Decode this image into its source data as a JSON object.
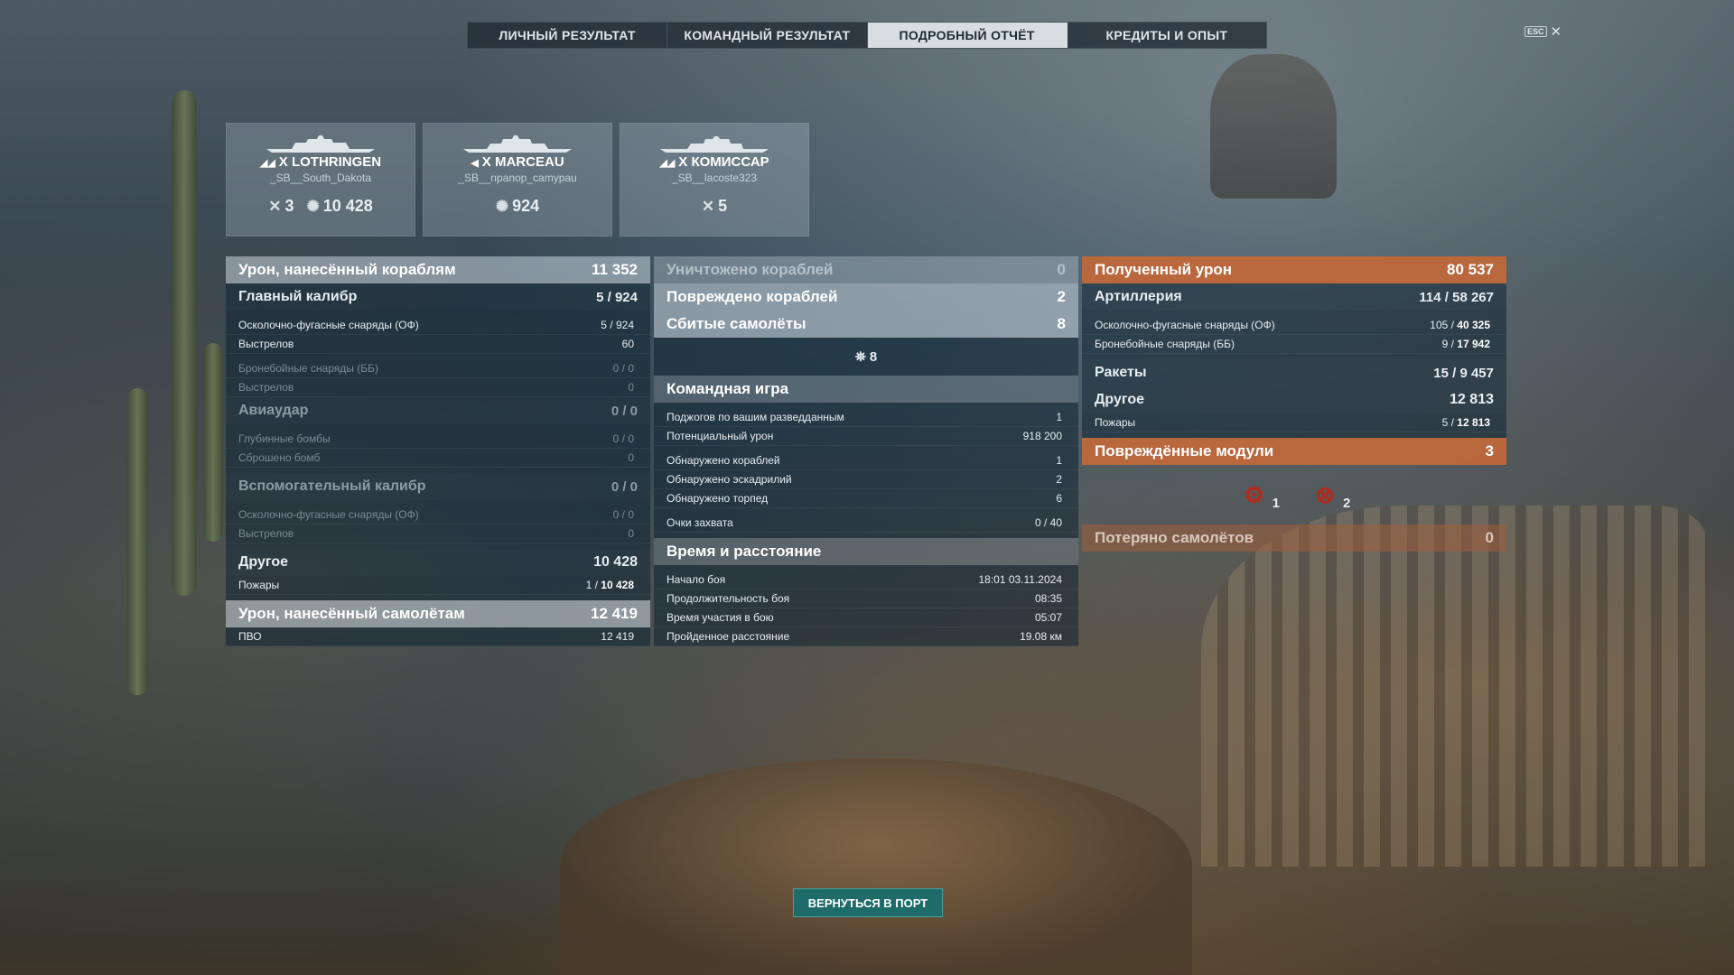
{
  "tabs": [
    {
      "label": "ЛИЧНЫЙ РЕЗУЛЬТАТ"
    },
    {
      "label": "КОМАНДНЫЙ РЕЗУЛЬТАТ"
    },
    {
      "label": "ПОДРОБНЫЙ ОТЧЁТ",
      "active": true
    },
    {
      "label": "КРЕДИТЫ И ОПЫТ"
    }
  ],
  "esc": {
    "key": "ESC",
    "close": "✕"
  },
  "ships": [
    {
      "tier": "X",
      "name": "LOTHRINGEN",
      "player": "_SB__South_Dakota",
      "kills": "3",
      "damage": "10 428"
    },
    {
      "tier": "X",
      "name": "MARCEAU",
      "player": "_SB__npanop_camypau",
      "damage": "924"
    },
    {
      "tier": "X",
      "name": "КОМИССАР",
      "player": "_SB__lacoste323",
      "kills": "5"
    }
  ],
  "left": {
    "ship_damage": {
      "label": "Урон, нанесённый кораблям",
      "value": "11 352"
    },
    "main_battery": {
      "label": "Главный калибр",
      "value": "5 / 924"
    },
    "he_shells": {
      "label": "Осколочно-фугасные снаряды (ОФ)",
      "value": "5 / 924"
    },
    "he_shots": {
      "label": "Выстрелов",
      "value": "60"
    },
    "ap_shells": {
      "label": "Бронебойные снаряды (ББ)",
      "value": "0 / 0"
    },
    "ap_shots": {
      "label": "Выстрелов",
      "value": "0"
    },
    "airstrike": {
      "label": "Авиаудар",
      "value": "0 / 0"
    },
    "depth_charges": {
      "label": "Глубинные бомбы",
      "value": "0 / 0"
    },
    "dropped": {
      "label": "Сброшено бомб",
      "value": "0"
    },
    "secondary": {
      "label": "Вспомогательный калибр",
      "value": "0 / 0"
    },
    "sec_he": {
      "label": "Осколочно-фугасные снаряды (ОФ)",
      "value": "0 / 0"
    },
    "sec_shots": {
      "label": "Выстрелов",
      "value": "0"
    },
    "other": {
      "label": "Другое",
      "value": "10 428"
    },
    "fires": {
      "label": "Пожары",
      "value_a": "1 / ",
      "value_b": "10 428"
    },
    "plane_damage": {
      "label": "Урон, нанесённый самолётам",
      "value": "12 419"
    },
    "aa": {
      "label": "ПВО",
      "value": "12 419"
    }
  },
  "middle": {
    "destroyed": {
      "label": "Уничтожено кораблей",
      "value": "0"
    },
    "damaged": {
      "label": "Повреждено кораблей",
      "value": "2"
    },
    "planes_shot": {
      "label": "Сбитые самолёты",
      "value": "8"
    },
    "planes_icon_count": "8",
    "team_play": {
      "label": "Командная игра"
    },
    "team_rows": [
      {
        "label": "Поджогов по вашим разведданным",
        "value": "1"
      },
      {
        "label": "Потенциальный урон",
        "value": "918 200"
      },
      {
        "label": "Обнаружено кораблей",
        "value": "1"
      },
      {
        "label": "Обнаружено эскадрилий",
        "value": "2"
      },
      {
        "label": "Обнаружено торпед",
        "value": "6"
      },
      {
        "label": "Очки захвата",
        "value": "0 / 40"
      }
    ],
    "time_distance": {
      "label": "Время и расстояние"
    },
    "time_rows": [
      {
        "label": "Начало боя",
        "value": "18:01  03.11.2024"
      },
      {
        "label": "Продолжительность боя",
        "value": "08:35"
      },
      {
        "label": "Время участия в бою",
        "value": "05:07"
      },
      {
        "label": "Пройденное расстояние",
        "value": "19.08 км"
      }
    ]
  },
  "right": {
    "received": {
      "label": "Полученный урон",
      "value": "80 537"
    },
    "artillery": {
      "label": "Артиллерия",
      "value": "114 / 58 267"
    },
    "art_he": {
      "label": "Осколочно-фугасные снаряды (ОФ)",
      "value_a": "105 / ",
      "value_b": "40 325"
    },
    "art_ap": {
      "label": "Бронебойные снаряды (ББ)",
      "value_a": "9 / ",
      "value_b": "17 942"
    },
    "rockets": {
      "label": "Ракеты",
      "value": "15 / 9 457"
    },
    "other": {
      "label": "Другое",
      "value": "12 813"
    },
    "fires": {
      "label": "Пожары",
      "value_a": "5 / ",
      "value_b": "12 813"
    },
    "modules": {
      "label": "Повреждённые модули",
      "value": "3"
    },
    "module_icons": [
      {
        "icon": "engine-module-icon",
        "count": "1"
      },
      {
        "icon": "steering-module-icon",
        "count": "2"
      }
    ],
    "planes_lost": {
      "label": "Потеряно самолётов",
      "value": "0"
    }
  },
  "return_button": "ВЕРНУТЬСЯ В ПОРТ"
}
